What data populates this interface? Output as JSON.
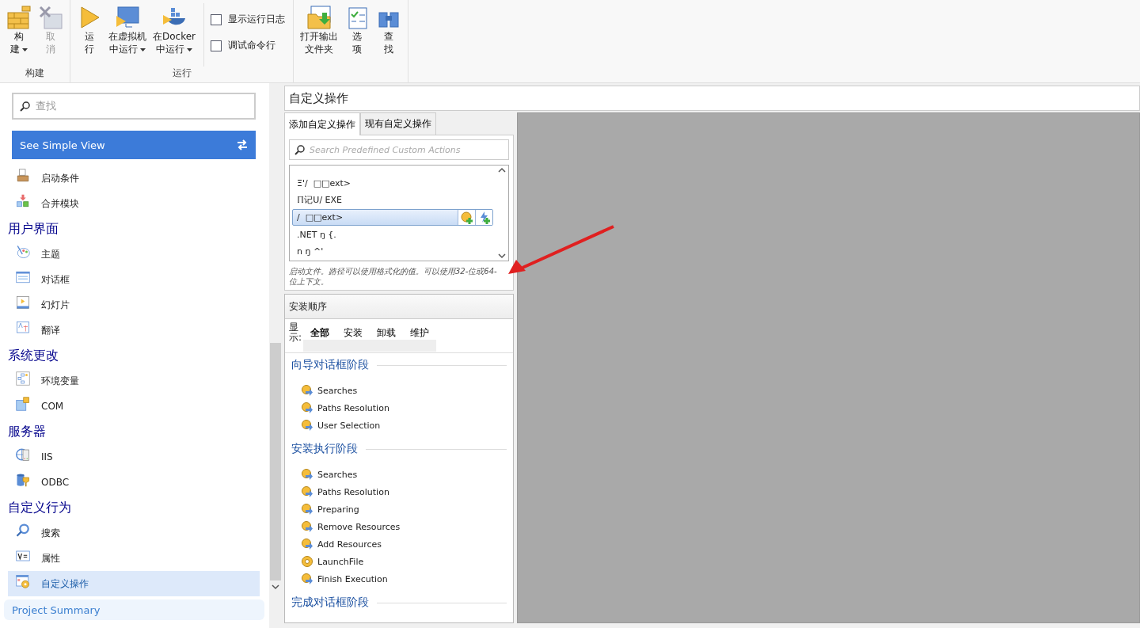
{
  "ribbon": {
    "groups": [
      {
        "label": "构建",
        "buttons": [
          {
            "kind": "build",
            "lines": [
              "构",
              "建"
            ],
            "dropdown": true,
            "disabled": false
          },
          {
            "kind": "cancel",
            "lines": [
              "取",
              "消"
            ],
            "dropdown": false,
            "disabled": true
          }
        ]
      },
      {
        "label": "运行",
        "buttons": [
          {
            "kind": "run",
            "lines": [
              "运",
              "行"
            ],
            "dropdown": false,
            "disabled": false
          },
          {
            "kind": "vm",
            "lines": [
              "在虚拟机",
              "中运行"
            ],
            "dropdown": true,
            "disabled": false
          },
          {
            "kind": "docker",
            "lines": [
              "在Docker",
              "中运行"
            ],
            "dropdown": true,
            "disabled": false
          }
        ],
        "checkboxes": [
          {
            "label": "显示运行日志",
            "checked": false
          },
          {
            "label": "调试命令行",
            "checked": false
          }
        ]
      },
      {
        "buttons": [
          {
            "kind": "folder",
            "lines": [
              "打开输出",
              "文件夹"
            ],
            "dropdown": false,
            "disabled": false
          },
          {
            "kind": "options",
            "lines": [
              "选",
              "项"
            ],
            "dropdown": false,
            "disabled": false
          },
          {
            "kind": "find",
            "lines": [
              "查",
              "找"
            ],
            "dropdown": false,
            "disabled": false
          }
        ]
      }
    ]
  },
  "sidebar": {
    "search": {
      "placeholder": "查找"
    },
    "simple_view_button": "See Simple View",
    "sections": [
      {
        "items": [
          {
            "kind": "box",
            "label": "启动条件",
            "selected": false
          },
          {
            "kind": "merge",
            "label": "合并模块",
            "selected": false
          }
        ]
      },
      {
        "title": "用户界面",
        "items": [
          {
            "kind": "palette",
            "label": "主题",
            "selected": false
          },
          {
            "kind": "dialog",
            "label": "对话框",
            "selected": false
          },
          {
            "kind": "slide",
            "label": "幻灯片",
            "selected": false
          },
          {
            "kind": "translate",
            "label": "翻译",
            "selected": false
          }
        ]
      },
      {
        "title": "系统更改",
        "items": [
          {
            "kind": "env",
            "label": "环境变量",
            "selected": false
          },
          {
            "kind": "com",
            "label": "COM",
            "selected": false
          }
        ]
      },
      {
        "title": "服务器",
        "items": [
          {
            "kind": "iis",
            "label": "IIS",
            "selected": false
          },
          {
            "kind": "odbc",
            "label": "ODBC",
            "selected": false
          }
        ]
      },
      {
        "title": "自定义行为",
        "items": [
          {
            "kind": "search",
            "label": "搜索",
            "selected": false
          },
          {
            "kind": "property",
            "label": "属性",
            "selected": false
          },
          {
            "kind": "customaction",
            "label": "自定义操作",
            "selected": true
          }
        ]
      }
    ],
    "project_summary": "Project Summary"
  },
  "panel": {
    "title": "自定义操作",
    "tabs": [
      {
        "label": "添加自定义操作",
        "selected": true
      },
      {
        "label": "现有自定义操作",
        "selected": false
      }
    ],
    "search": {
      "placeholder": "Search Predefined Custom Actions"
    },
    "actions": [
      {
        "label": "Ξ'/  □□ext>",
        "selected": false
      },
      {
        "label": "ℿ记U/ EXE",
        "selected": false
      },
      {
        "label": "/  □□ext>",
        "selected": true
      },
      {
        "label": ".NET ŋ {.",
        "selected": false
      },
      {
        "label": "ո ŋ ^'",
        "selected": false
      }
    ],
    "description": "启动文件。路径可以使用格式化的值。可以使用32-位或64-位上下文。",
    "sequence": {
      "title": "安装顺序",
      "filter_label": "显示:",
      "filters": [
        {
          "label": "全部",
          "selected": true
        },
        {
          "label": "安装",
          "selected": false
        },
        {
          "label": "卸载",
          "selected": false
        },
        {
          "label": "维护",
          "selected": false
        }
      ],
      "stages": [
        {
          "title": "向导对话框阶段",
          "items": [
            {
              "kind": "stage",
              "label": "Searches"
            },
            {
              "kind": "stage",
              "label": "Paths Resolution"
            },
            {
              "kind": "stage",
              "label": "User Selection"
            }
          ]
        },
        {
          "title": "安装执行阶段",
          "items": [
            {
              "kind": "stage",
              "label": "Searches"
            },
            {
              "kind": "stage",
              "label": "Paths Resolution"
            },
            {
              "kind": "stage",
              "label": "Preparing"
            },
            {
              "kind": "stage",
              "label": "Remove Resources"
            },
            {
              "kind": "stage",
              "label": "Add Resources"
            },
            {
              "kind": "action",
              "label": "LaunchFile"
            },
            {
              "kind": "stage",
              "label": "Finish Execution"
            }
          ]
        },
        {
          "title": "完成对话框阶段"
        }
      ]
    }
  }
}
